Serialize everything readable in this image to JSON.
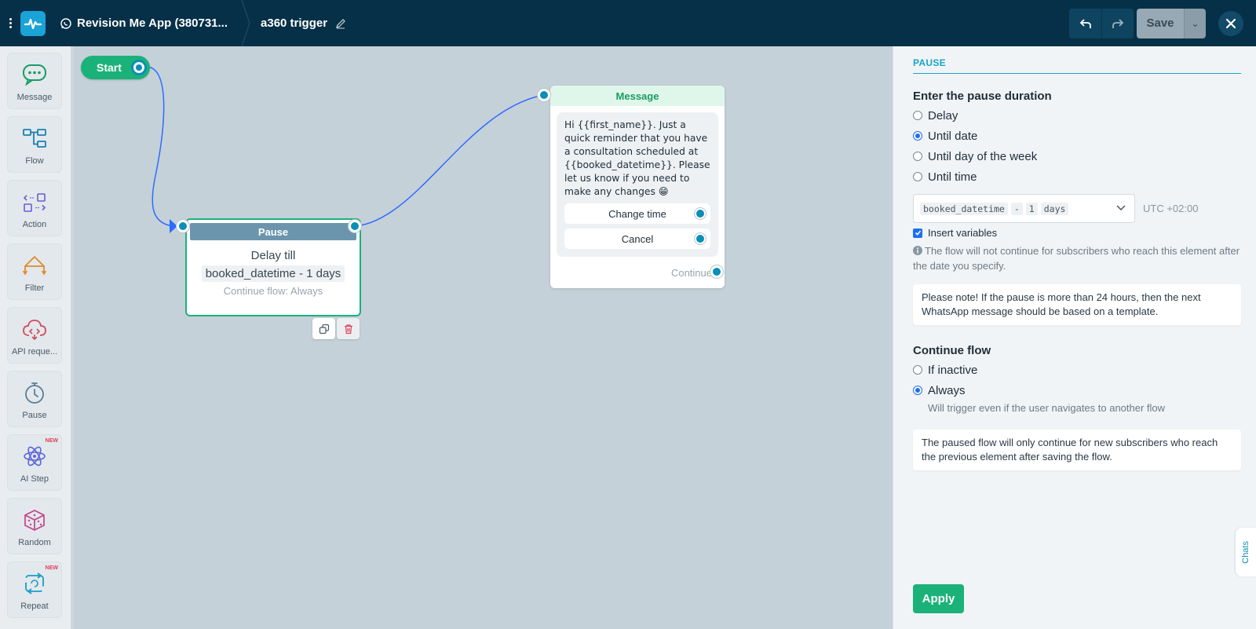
{
  "topbar": {
    "app_name": "Revision Me App (380731...",
    "flow_name": "a360 trigger",
    "save_label": "Save",
    "dropdown_glyph": "⌄"
  },
  "sidebar": {
    "items": [
      {
        "label": "Message",
        "icon": "message-icon",
        "badge": ""
      },
      {
        "label": "Flow",
        "icon": "flow-icon",
        "badge": ""
      },
      {
        "label": "Action",
        "icon": "action-icon",
        "badge": ""
      },
      {
        "label": "Filter",
        "icon": "filter-icon",
        "badge": ""
      },
      {
        "label": "API reque...",
        "icon": "api-icon",
        "badge": ""
      },
      {
        "label": "Pause",
        "icon": "stopwatch-icon",
        "badge": ""
      },
      {
        "label": "AI Step",
        "icon": "ai-icon",
        "badge": "NEW"
      },
      {
        "label": "Random",
        "icon": "dice-icon",
        "badge": ""
      },
      {
        "label": "Repeat",
        "icon": "repeat-icon",
        "badge": "NEW"
      }
    ]
  },
  "canvas": {
    "start_label": "Start",
    "pause_node": {
      "title": "Pause",
      "line1": "Delay till",
      "variable": "booked_datetime - 1 days",
      "continue": "Continue flow: Always"
    },
    "message_node": {
      "title": "Message",
      "text": "Hi {{first_name}}. Just a quick reminder that you have a consultation scheduled at {{booked_datetime}}. Please let us know if you need to make any changes 😁",
      "buttons": [
        "Change time",
        "Cancel"
      ],
      "continue": "Continue"
    },
    "chats_tab": "Chats"
  },
  "panel": {
    "title": "PAUSE",
    "duration_heading": "Enter the pause duration",
    "duration_options": [
      "Delay",
      "Until date",
      "Until day of the week",
      "Until time"
    ],
    "duration_selected": 1,
    "select_chips": [
      "booked_datetime",
      "-",
      "1",
      "days"
    ],
    "timezone": "UTC +02:00",
    "insert_variables": "Insert variables",
    "info": "The flow will not continue for subscribers who reach this element after the date you specify.",
    "note1": "Please note! If the pause is more than 24 hours, then the next WhatsApp message should be based on a template.",
    "continue_heading": "Continue flow",
    "continue_options": [
      "If inactive",
      "Always"
    ],
    "continue_selected": 1,
    "always_hint": "Will trigger even if the user navigates to another flow",
    "note2": "The paused flow will only continue for new subscribers who reach the previous element after saving the flow.",
    "apply_label": "Apply"
  },
  "colors": {
    "topbar": "#063048",
    "accent_green": "#1bb27a",
    "port_blue": "#0a8fb6",
    "connector": "#2f6bff",
    "panel_title": "#1aa3c8"
  }
}
